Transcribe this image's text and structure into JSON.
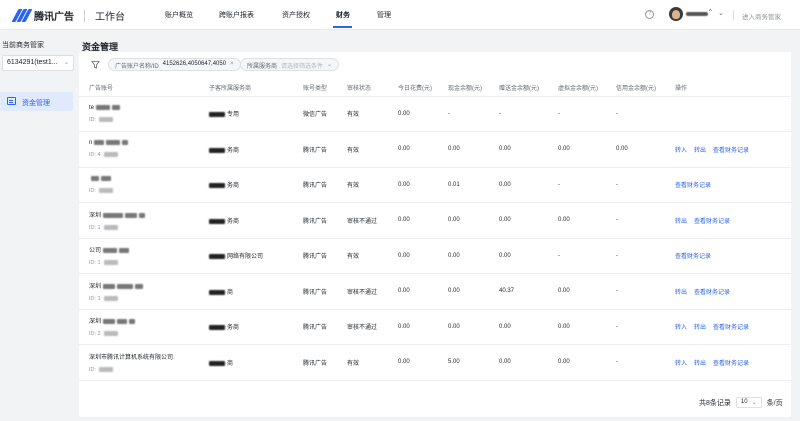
{
  "brand": {
    "name": "腾讯广告",
    "workspace": "工作台"
  },
  "nav": [
    {
      "label": "账户概览",
      "active": false
    },
    {
      "label": "跨账户报表",
      "active": false
    },
    {
      "label": "资产授权",
      "active": false
    },
    {
      "label": "财务",
      "active": true
    },
    {
      "label": "管理",
      "active": false
    }
  ],
  "header": {
    "help_icon": "?",
    "user_name_caret": "^",
    "enter_manager": "进入商务管家"
  },
  "sidebar": {
    "label": "当前商务管家",
    "account_select": "6134291(test1...",
    "menu_item": "资金管理",
    "menu_icon": "wallet-icon"
  },
  "page": {
    "title": "资金管理"
  },
  "filters": {
    "account_chip_key": "广告账户名称/ID",
    "account_chip_value": "4152626,4050647,4050",
    "service_chip_key": "所属服务商",
    "service_chip_placeholder": "请选择筛选条件"
  },
  "table": {
    "columns": [
      "广告账号",
      "子客所属服务商",
      "账号类型",
      "审核状态",
      "今日花费(元)",
      "现金余额(元)",
      "赠送金余额(元)",
      "虚拟金余额(元)",
      "信用金余额(元)",
      "操作"
    ],
    "rows": [
      {
        "name": "te",
        "id": "ID:",
        "service": "专用",
        "type": "微信广告",
        "status": "有效",
        "spend": "0.00",
        "cash": "-",
        "gift": "-",
        "virtual": "-",
        "credit": "-",
        "ops": []
      },
      {
        "name": "n",
        "id": "ID: 4",
        "service": "务商",
        "type": "腾讯广告",
        "status": "有效",
        "spend": "0.00",
        "cash": "0.00",
        "gift": "0.00",
        "virtual": "0.00",
        "credit": "0.00",
        "ops": [
          "转入",
          "转出",
          "查看财务记录"
        ]
      },
      {
        "name": "",
        "id": "ID:",
        "service": "务商",
        "type": "腾讯广告",
        "status": "有效",
        "spend": "0.00",
        "cash": "0.01",
        "gift": "0.00",
        "virtual": "-",
        "credit": "-",
        "ops": [
          "查看财务记录"
        ]
      },
      {
        "name": "深圳",
        "id": "ID: 1",
        "service": "务商",
        "type": "腾讯广告",
        "status": "审核不通过",
        "spend": "0.00",
        "cash": "0.00",
        "gift": "0.00",
        "virtual": "0.00",
        "credit": "-",
        "ops": [
          "转出",
          "查看财务记录"
        ]
      },
      {
        "name": "公司",
        "id": "ID: 1",
        "service": "网络有限公司",
        "type": "腾讯广告",
        "status": "有效",
        "spend": "0.00",
        "cash": "0.00",
        "gift": "0.00",
        "virtual": "-",
        "credit": "-",
        "ops": [
          "查看财务记录"
        ]
      },
      {
        "name": "深圳",
        "id": "ID: 1",
        "service": "商",
        "type": "腾讯广告",
        "status": "审核不通过",
        "spend": "0.00",
        "cash": "0.00",
        "gift": "40.37",
        "virtual": "0.00",
        "credit": "-",
        "ops": [
          "转出",
          "查看财务记录"
        ]
      },
      {
        "name": "深圳",
        "id": "ID: 2",
        "service": "务商",
        "type": "腾讯广告",
        "status": "审核不通过",
        "spend": "0.00",
        "cash": "0.00",
        "gift": "0.00",
        "virtual": "0.00",
        "credit": "-",
        "ops": [
          "转入",
          "转出",
          "查看财务记录"
        ]
      },
      {
        "name": "深圳市腾讯计算机系统有限公司",
        "id": "ID:",
        "service": "商",
        "type": "腾讯广告",
        "status": "有效",
        "spend": "0.00",
        "cash": "5.00",
        "gift": "0.00",
        "virtual": "0.00",
        "credit": "-",
        "ops": [
          "转入",
          "转出",
          "查看财务记录"
        ]
      }
    ]
  },
  "pagination": {
    "total": "共8条记录",
    "page_size": "10",
    "per_page": "条/页"
  }
}
